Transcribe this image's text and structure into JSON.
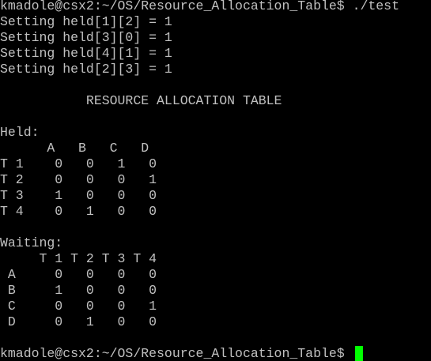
{
  "terminal": {
    "background": "#000000",
    "foreground": "#c0c0c0",
    "cursor_color": "#00ff00",
    "lines": [
      "kmadole@csx2:~/OS/Resource_Allocation_Table$ ./test",
      "Setting held[1][2] = 1",
      "Setting held[3][0] = 1",
      "Setting held[4][1] = 1",
      "Setting held[2][3] = 1",
      "",
      "           RESOURCE ALLOCATION TABLE",
      "",
      "Held:",
      "      A   B   C   D",
      "T 1    0   0   1   0",
      "T 2    0   0   0   1",
      "T 3    1   0   0   0",
      "T 4    0   1   0   0",
      "",
      "Waiting:",
      "     T 1 T 2 T 3 T 4",
      " A     0   0   0   0",
      " B     1   0   0   0",
      " C     0   0   0   1",
      " D     0   1   0   0",
      "",
      "kmadole@csx2:~/OS/Resource_Allocation_Table$ "
    ]
  }
}
